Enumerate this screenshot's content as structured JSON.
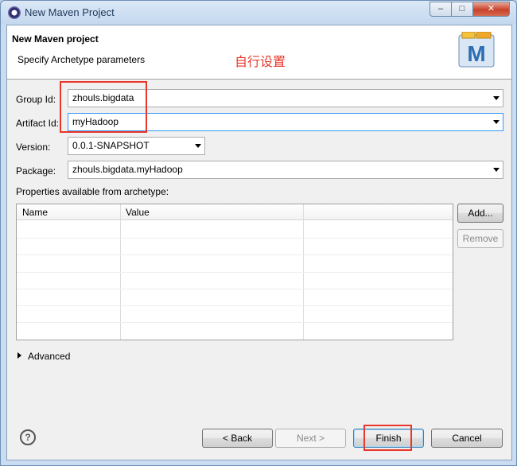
{
  "window": {
    "title": "New Maven Project",
    "minimize": "–",
    "maximize": "□",
    "close": "✕"
  },
  "header": {
    "title": "New Maven project",
    "subtitle": "Specify Archetype parameters",
    "annotation": "自行设置",
    "icon": "maven-M-icon",
    "icon_letter": "M"
  },
  "form": {
    "group_id_label": "Group Id:",
    "group_id_value": "zhouls.bigdata",
    "artifact_id_label": "Artifact Id:",
    "artifact_id_value": "myHadoop",
    "version_label": "Version:",
    "version_value": "0.0.1-SNAPSHOT",
    "package_label": "Package:",
    "package_value": "zhouls.bigdata.myHadoop"
  },
  "properties": {
    "label": "Properties available from archetype:",
    "columns": [
      "Name",
      "Value"
    ],
    "rows": [],
    "add_label": "Add...",
    "remove_label": "Remove"
  },
  "advanced_label": "Advanced",
  "footer": {
    "help_label": "?",
    "back_label": "< Back",
    "next_label": "Next >",
    "finish_label": "Finish",
    "cancel_label": "Cancel"
  },
  "colors": {
    "annotation_red": "#e8372a",
    "focus_blue": "#3399ff"
  }
}
